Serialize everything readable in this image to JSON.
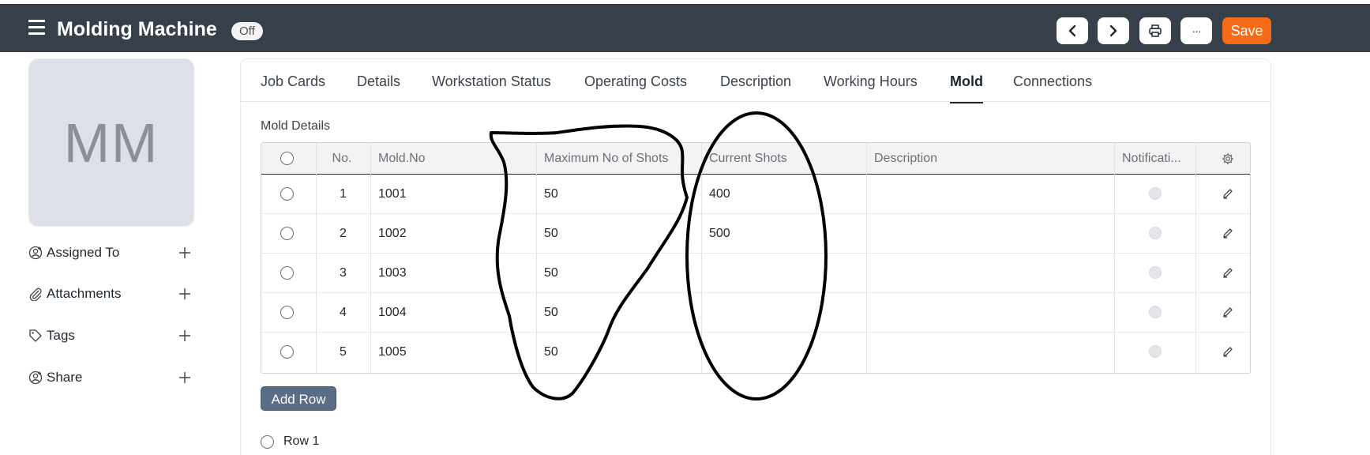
{
  "header": {
    "title": "Molding Machine",
    "status": "Off",
    "prev_icon": "chevron-left-icon",
    "next_icon": "chevron-right-icon",
    "print_icon": "printer-icon",
    "more_label": "···",
    "save_label": "Save",
    "save_color": "#f56b18"
  },
  "sidebar": {
    "avatar_initials": "MM",
    "items": [
      {
        "label": "Assigned To",
        "icon": "user-add-icon"
      },
      {
        "label": "Attachments",
        "icon": "paperclip-icon"
      },
      {
        "label": "Tags",
        "icon": "tag-icon"
      },
      {
        "label": "Share",
        "icon": "share-user-icon"
      }
    ]
  },
  "tabs": [
    {
      "label": "Job Cards",
      "active": false
    },
    {
      "label": "Details",
      "active": false
    },
    {
      "label": "Workstation Status",
      "active": false
    },
    {
      "label": "Operating Costs",
      "active": false
    },
    {
      "label": "Description",
      "active": false
    },
    {
      "label": "Working Hours",
      "active": false
    },
    {
      "label": "Mold",
      "active": true
    },
    {
      "label": "Connections",
      "active": false
    }
  ],
  "mold": {
    "section_label": "Mold Details",
    "columns": {
      "no": "No.",
      "mold_no": "Mold.No",
      "max_shots": "Maximum No of Shots",
      "current_shots": "Current Shots",
      "description": "Description",
      "notification": "Notificati..."
    },
    "rows": [
      {
        "no": "1",
        "mold_no": "1001",
        "max_shots": "50",
        "current_shots": "400",
        "description": ""
      },
      {
        "no": "2",
        "mold_no": "1002",
        "max_shots": "50",
        "current_shots": "500",
        "description": ""
      },
      {
        "no": "3",
        "mold_no": "1003",
        "max_shots": "50",
        "current_shots": "",
        "description": ""
      },
      {
        "no": "4",
        "mold_no": "1004",
        "max_shots": "50",
        "current_shots": "",
        "description": ""
      },
      {
        "no": "5",
        "mold_no": "1005",
        "max_shots": "50",
        "current_shots": "",
        "description": ""
      }
    ],
    "add_row_label": "Add Row",
    "row_option_label": "Row 1"
  }
}
